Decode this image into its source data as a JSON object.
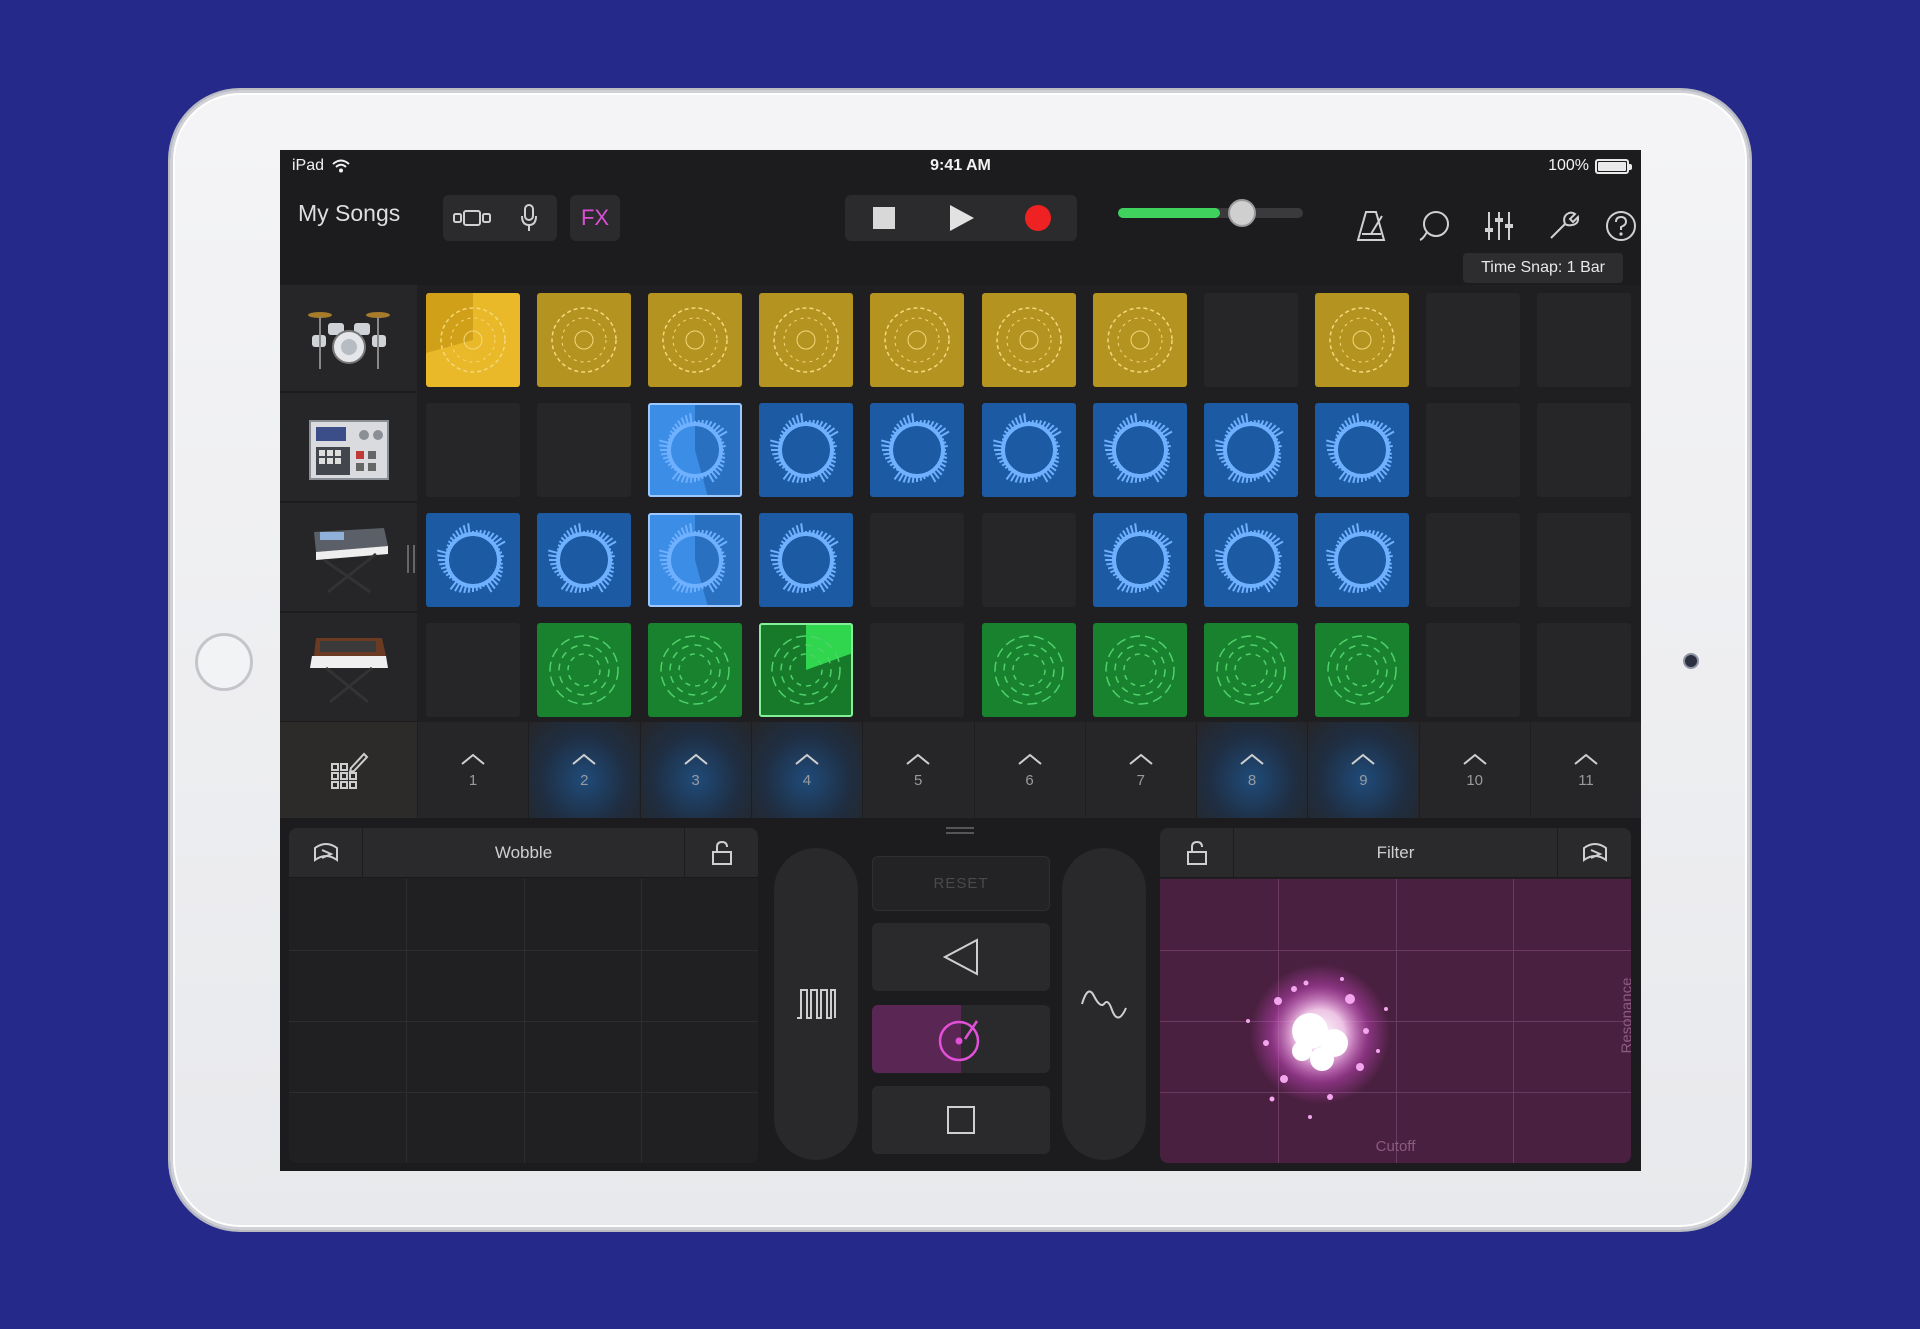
{
  "status": {
    "device": "iPad",
    "time": "9:41 AM",
    "battery": "100%"
  },
  "toolbar": {
    "my_songs": "My Songs",
    "fx_label": "FX",
    "volume_level": 0.55
  },
  "time_snap": "Time Snap: 1 Bar",
  "instruments": [
    "drum-kit",
    "beat-machine",
    "keyboard-synth",
    "analog-synth"
  ],
  "triggers": [
    "1",
    "2",
    "3",
    "4",
    "5",
    "6",
    "7",
    "8",
    "9",
    "10",
    "11"
  ],
  "triggers_lit": [
    2,
    3,
    4,
    8,
    9
  ],
  "grid": [
    [
      "yellow-playing",
      "yellow",
      "yellow",
      "yellow",
      "yellow",
      "yellow",
      "yellow",
      "empty",
      "yellow",
      "empty",
      "empty"
    ],
    [
      "empty",
      "empty",
      "blue-playing",
      "blue",
      "blue",
      "blue",
      "blue",
      "blue",
      "blue",
      "empty",
      "empty"
    ],
    [
      "blue",
      "blue",
      "blue-playing",
      "blue",
      "empty",
      "empty",
      "blue",
      "blue",
      "blue",
      "empty",
      "empty"
    ],
    [
      "empty",
      "green",
      "green",
      "green-playing",
      "empty",
      "green",
      "green",
      "green",
      "green",
      "empty",
      "empty"
    ]
  ],
  "fx": {
    "left_panel_title": "Wobble",
    "right_panel_title": "Filter",
    "reset_label": "RESET",
    "x_axis": "Cutoff",
    "y_axis": "Resonance"
  },
  "colors": {
    "yellow": "#e9b92a",
    "blue": "#3b8de6",
    "green": "#19822e",
    "record": "#ee2222",
    "fx": "#d94fd6",
    "filter_pad": "#4a2040"
  }
}
